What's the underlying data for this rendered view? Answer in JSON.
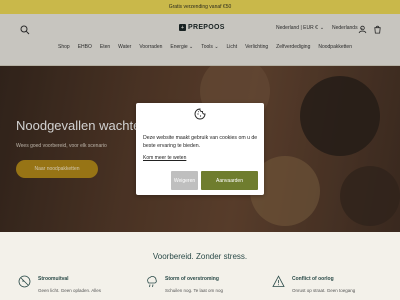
{
  "announcement": "Gratis verzending vanaf €50",
  "header": {
    "logo_text": "PREPOOS",
    "currency_selector": "Nederland | EUR €",
    "language_selector": "Nederlands"
  },
  "nav": [
    "Shop",
    "EHBO",
    "Eten",
    "Water",
    "Voorraden",
    "Energie",
    "Tools",
    "Licht",
    "Verlichting",
    "Zelfverdediging",
    "Noodpakketten"
  ],
  "hero": {
    "title": "Noodgevallen wachten niet",
    "subtitle": "Wees goed voorbereid, voor elk scenario",
    "button": "Naar noodpakketten"
  },
  "cookie": {
    "text": "Deze website maakt gebruik van cookies om u de beste ervaring te bieden.",
    "link": "Kom meer te weten",
    "decline": "Weigeren",
    "accept": "Aanvaarden"
  },
  "section_title": "Voorbereid. Zonder stress.",
  "features": [
    {
      "title": "Stroomuitval",
      "subtitle": "Geen licht. Geen opladen. Alles",
      "icon": "outlet-icon"
    },
    {
      "title": "Storm of overstroming",
      "subtitle": "Schuilen nog. Te laat om nog",
      "icon": "storm-icon"
    },
    {
      "title": "Conflict of oorlog",
      "subtitle": "Onrust op straat. Geen toegang",
      "icon": "alert-icon"
    }
  ],
  "colors": {
    "accent": "#6f7d2e",
    "hero_button": "#b98e1a",
    "announcement_bar": "#c9b84a"
  }
}
